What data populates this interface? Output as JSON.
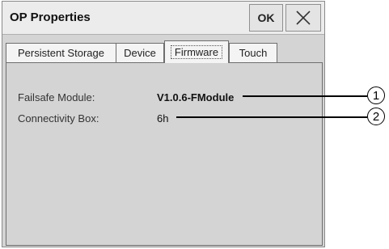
{
  "window": {
    "title": "OP Properties",
    "ok_label": "OK"
  },
  "tabs": [
    {
      "label": "Persistent Storage",
      "active": false
    },
    {
      "label": "Device",
      "active": false
    },
    {
      "label": "Firmware",
      "active": true
    },
    {
      "label": "Touch",
      "active": false
    }
  ],
  "firmware": {
    "failsafe_label": "Failsafe Module:",
    "failsafe_value": "V1.0.6-FModule",
    "connectivity_label": "Connectivity Box:",
    "connectivity_value": "6h"
  },
  "callouts": [
    "1",
    "2"
  ],
  "icons": {
    "close": "close-icon"
  }
}
